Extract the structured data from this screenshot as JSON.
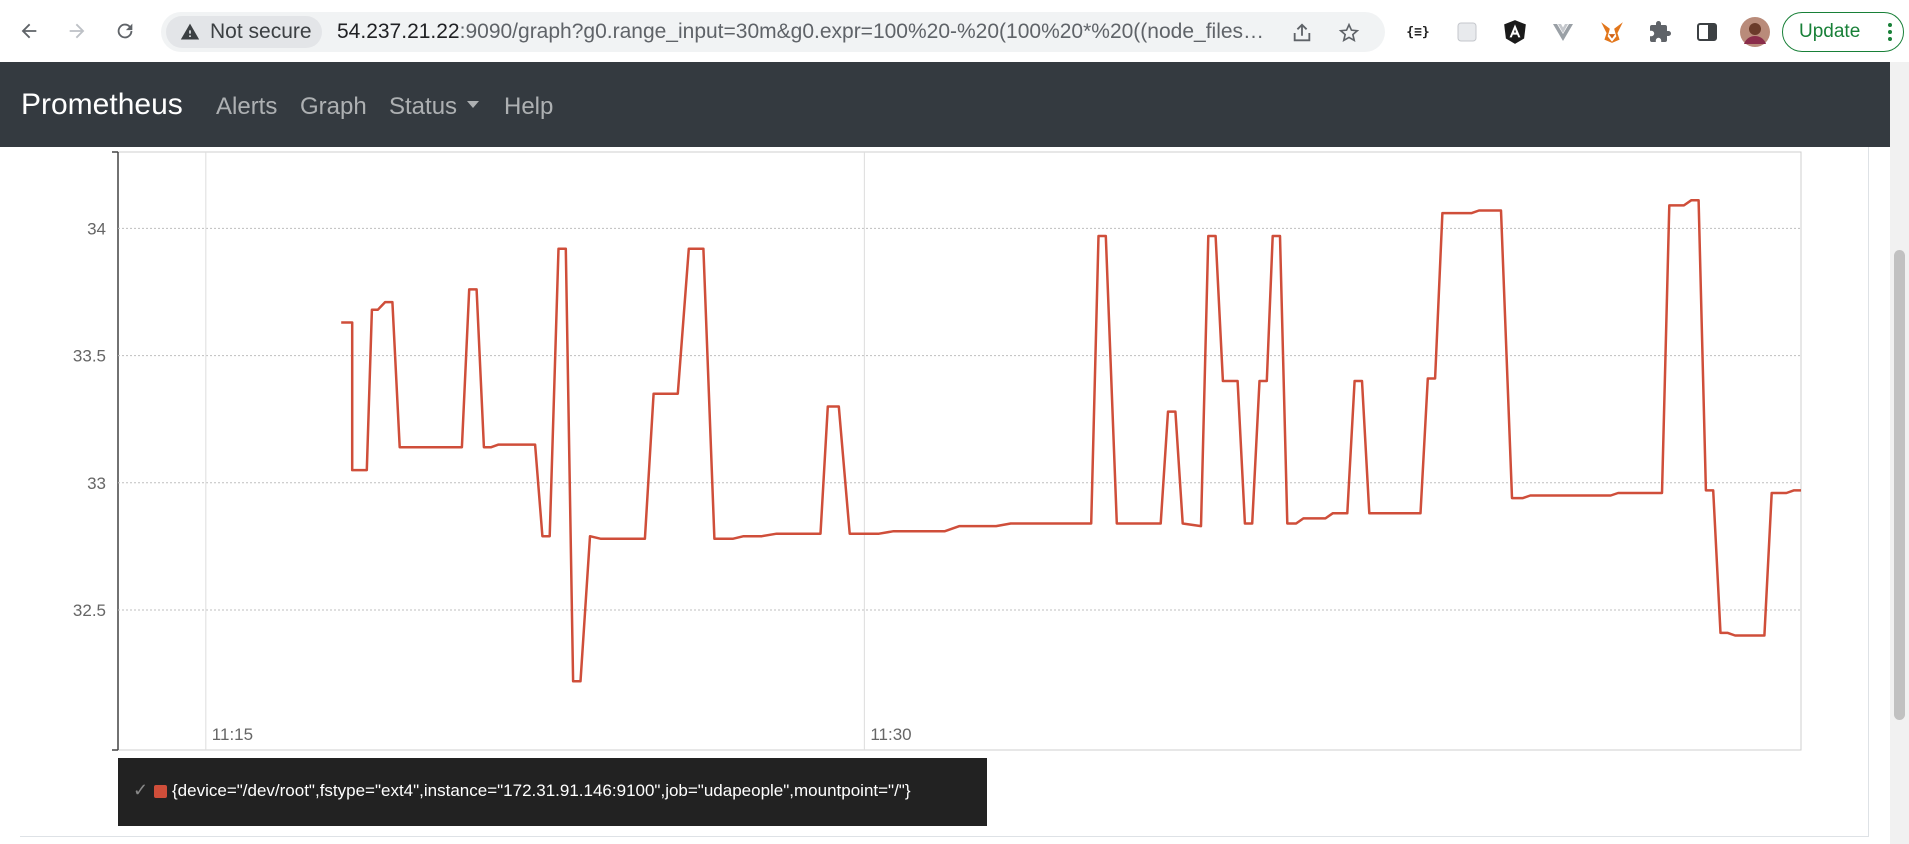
{
  "browser": {
    "security_label": "Not secure",
    "url_host": "54.237.21.22",
    "url_rest": ":9090/graph?g0.range_input=30m&g0.expr=100%20-%20(100%20*%20((node_filesyste...",
    "update_label": "Update",
    "extensions": [
      "json-viewer-icon",
      "extension-grey-icon",
      "angular-icon",
      "vue-icon",
      "metamask-fox-icon",
      "puzzle-extensions-icon",
      "side-panel-icon",
      "profile-avatar"
    ]
  },
  "navbar": {
    "brand": "Prometheus",
    "links": [
      "Alerts",
      "Graph",
      "Status",
      "Help"
    ],
    "background": "#343a40"
  },
  "chart_data": {
    "type": "line",
    "series": [
      {
        "name": "{device=\"/dev/root\",fstype=\"ext4\",instance=\"172.31.91.146:9100\",job=\"udapeople\",mountpoint=\"/\"}",
        "color": "#cf4e3a",
        "points": [
          [
            "11:18:05",
            33.63
          ],
          [
            "11:18:20",
            33.63
          ],
          [
            "11:18:20",
            33.05
          ],
          [
            "11:18:40",
            33.05
          ],
          [
            "11:18:47",
            33.68
          ],
          [
            "11:18:55",
            33.68
          ],
          [
            "11:19:05",
            33.71
          ],
          [
            "11:19:15",
            33.71
          ],
          [
            "11:19:25",
            33.14
          ],
          [
            "11:20:50",
            33.14
          ],
          [
            "11:21:00",
            33.76
          ],
          [
            "11:21:10",
            33.76
          ],
          [
            "11:21:20",
            33.14
          ],
          [
            "11:21:30",
            33.14
          ],
          [
            "11:21:40",
            33.15
          ],
          [
            "11:22:30",
            33.15
          ],
          [
            "11:22:40",
            32.79
          ],
          [
            "11:22:50",
            32.79
          ],
          [
            "11:23:02",
            33.92
          ],
          [
            "11:23:12",
            33.92
          ],
          [
            "11:23:22",
            32.22
          ],
          [
            "11:23:32",
            32.22
          ],
          [
            "11:23:45",
            32.79
          ],
          [
            "11:24:00",
            32.78
          ],
          [
            "11:25:00",
            32.78
          ],
          [
            "11:25:12",
            33.35
          ],
          [
            "11:25:45",
            33.35
          ],
          [
            "11:26:00",
            33.92
          ],
          [
            "11:26:20",
            33.92
          ],
          [
            "11:26:35",
            32.78
          ],
          [
            "11:27:00",
            32.78
          ],
          [
            "11:27:15",
            32.79
          ],
          [
            "11:27:40",
            32.79
          ],
          [
            "11:28:00",
            32.8
          ],
          [
            "11:28:30",
            32.8
          ],
          [
            "11:29:00",
            32.8
          ],
          [
            "11:29:10",
            33.3
          ],
          [
            "11:29:25",
            33.3
          ],
          [
            "11:29:40",
            32.8
          ],
          [
            "11:30:20",
            32.8
          ],
          [
            "11:30:40",
            32.81
          ],
          [
            "11:31:50",
            32.81
          ],
          [
            "11:32:10",
            32.83
          ],
          [
            "11:33:00",
            32.83
          ],
          [
            "11:33:20",
            32.84
          ],
          [
            "11:34:10",
            32.84
          ],
          [
            "11:34:30",
            32.84
          ],
          [
            "11:35:10",
            32.84
          ],
          [
            "11:35:20",
            33.97
          ],
          [
            "11:35:30",
            33.97
          ],
          [
            "11:35:45",
            32.84
          ],
          [
            "11:36:45",
            32.84
          ],
          [
            "11:36:55",
            33.28
          ],
          [
            "11:37:05",
            33.28
          ],
          [
            "11:37:15",
            32.84
          ],
          [
            "11:37:40",
            32.83
          ],
          [
            "11:37:50",
            33.97
          ],
          [
            "11:38:00",
            33.97
          ],
          [
            "11:38:10",
            33.4
          ],
          [
            "11:38:30",
            33.4
          ],
          [
            "11:38:40",
            32.84
          ],
          [
            "11:38:50",
            32.84
          ],
          [
            "11:39:00",
            33.4
          ],
          [
            "11:39:10",
            33.4
          ],
          [
            "11:39:18",
            33.97
          ],
          [
            "11:39:28",
            33.97
          ],
          [
            "11:39:38",
            32.84
          ],
          [
            "11:39:50",
            32.84
          ],
          [
            "11:40:00",
            32.86
          ],
          [
            "11:40:30",
            32.86
          ],
          [
            "11:40:40",
            32.88
          ],
          [
            "11:41:00",
            32.88
          ],
          [
            "11:41:10",
            33.4
          ],
          [
            "11:41:20",
            33.4
          ],
          [
            "11:41:30",
            32.88
          ],
          [
            "11:42:40",
            32.88
          ],
          [
            "11:42:50",
            33.41
          ],
          [
            "11:43:00",
            33.41
          ],
          [
            "11:43:10",
            34.06
          ],
          [
            "11:43:50",
            34.06
          ],
          [
            "11:44:00",
            34.07
          ],
          [
            "11:44:30",
            34.07
          ],
          [
            "11:44:45",
            32.94
          ],
          [
            "11:45:00",
            32.94
          ],
          [
            "11:45:10",
            32.95
          ],
          [
            "11:46:00",
            32.95
          ],
          [
            "11:47:00",
            32.95
          ],
          [
            "11:47:10",
            32.96
          ],
          [
            "11:48:00",
            32.96
          ],
          [
            "11:48:10",
            32.96
          ],
          [
            "11:48:20",
            34.09
          ],
          [
            "11:48:40",
            34.09
          ],
          [
            "11:48:50",
            34.11
          ],
          [
            "11:49:00",
            34.11
          ],
          [
            "11:49:10",
            32.97
          ],
          [
            "11:49:20",
            32.97
          ],
          [
            "11:49:30",
            32.41
          ],
          [
            "11:49:40",
            32.41
          ],
          [
            "11:49:50",
            32.4
          ],
          [
            "11:50:30",
            32.4
          ],
          [
            "11:50:40",
            32.96
          ],
          [
            "11:51:00",
            32.96
          ],
          [
            "11:51:10",
            32.97
          ],
          [
            "11:51:20",
            32.97
          ]
        ]
      }
    ],
    "x_ticks": [
      "11:15",
      "11:30"
    ],
    "y_ticks": [
      "32.5",
      "33",
      "33.5",
      "34"
    ],
    "xlim": [
      "11:13:00",
      "11:51:20"
    ],
    "ylim": [
      31.95,
      34.3
    ],
    "grid": true,
    "legend": "bottom-left",
    "legend_check": "✓"
  }
}
